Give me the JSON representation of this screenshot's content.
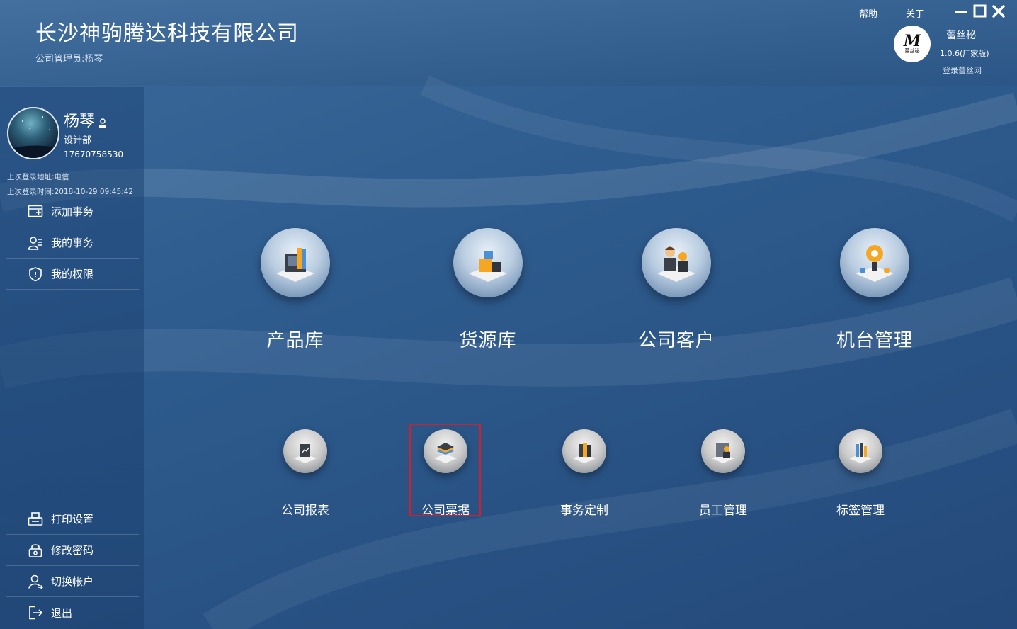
{
  "header": {
    "company_name": "长沙神驹腾达科技有限公司",
    "admin_label": "公司管理员:杨琴",
    "help": "帮助",
    "about": "关于",
    "brand": {
      "logo_mark": "M",
      "logo_text": "蕾丝秘",
      "name": "蕾丝秘",
      "version": "1.0.6(厂家版)",
      "login_link": "登录蕾丝网"
    }
  },
  "user": {
    "name": "杨琴",
    "department": "设计部",
    "phone": "17670758530",
    "last_login_addr": "上次登录地址:电信",
    "last_login_time": "上次登录时间:2018-10-29 09:45:42"
  },
  "sidebar": {
    "top_items": [
      {
        "label": "添加事务",
        "icon": "add-task-icon"
      },
      {
        "label": "我的事务",
        "icon": "my-tasks-icon"
      },
      {
        "label": "我的权限",
        "icon": "shield-icon"
      }
    ],
    "bottom_items": [
      {
        "label": "打印设置",
        "icon": "printer-icon"
      },
      {
        "label": "修改密码",
        "icon": "lock-icon"
      },
      {
        "label": "切换帐户",
        "icon": "user-switch-icon"
      },
      {
        "label": "退出",
        "icon": "logout-icon"
      }
    ]
  },
  "main": {
    "big_tiles": [
      {
        "label": "产品库",
        "icon": "product-library-icon"
      },
      {
        "label": "货源库",
        "icon": "supply-library-icon"
      },
      {
        "label": "公司客户",
        "icon": "customers-icon"
      },
      {
        "label": "机台管理",
        "icon": "machine-management-icon"
      }
    ],
    "small_tiles": [
      {
        "label": "公司报表",
        "icon": "report-icon"
      },
      {
        "label": "公司票据",
        "icon": "invoice-icon",
        "selected": true
      },
      {
        "label": "事务定制",
        "icon": "task-custom-icon"
      },
      {
        "label": "员工管理",
        "icon": "staff-icon"
      },
      {
        "label": "标签管理",
        "icon": "tag-icon"
      }
    ],
    "highlight_color": "#d0202e"
  }
}
